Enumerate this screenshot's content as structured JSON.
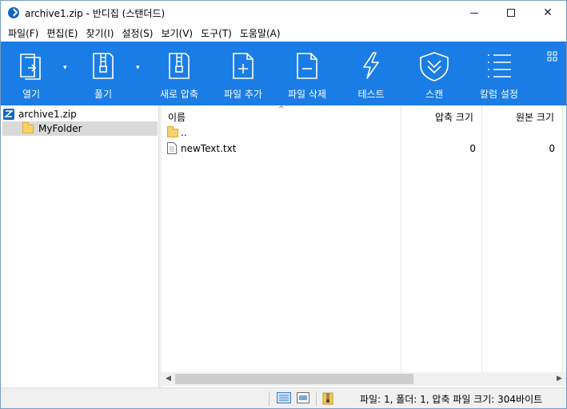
{
  "window": {
    "title": "archive1.zip - 반디집 (스탠더드)"
  },
  "menu": [
    {
      "label": "파일(F)"
    },
    {
      "label": "편집(E)"
    },
    {
      "label": "찾기(I)"
    },
    {
      "label": "설정(S)"
    },
    {
      "label": "보기(V)"
    },
    {
      "label": "도구(T)"
    },
    {
      "label": "도움말(A)"
    }
  ],
  "toolbar": {
    "open_label": "열기",
    "extract_label": "풀기",
    "new_archive_label": "새로 압축",
    "add_file_label": "파일 추가",
    "delete_file_label": "파일 삭제",
    "test_label": "테스트",
    "scan_label": "스캔",
    "column_settings_label": "칼럼 설정"
  },
  "tree": {
    "root": "archive1.zip",
    "folder": "MyFolder"
  },
  "list": {
    "columns": {
      "name": "이름",
      "packed": "압축 크기",
      "original": "원본 크기"
    },
    "rows": [
      {
        "name": "..",
        "packed": "",
        "original": ""
      },
      {
        "name": "newText.txt",
        "packed": "0",
        "original": "0"
      }
    ]
  },
  "status": {
    "text": "파일: 1, 폴더: 1, 압축 파일 크기: 304바이트"
  },
  "colors": {
    "toolbar": "#1a7de6",
    "folder": "#f6d26a"
  }
}
